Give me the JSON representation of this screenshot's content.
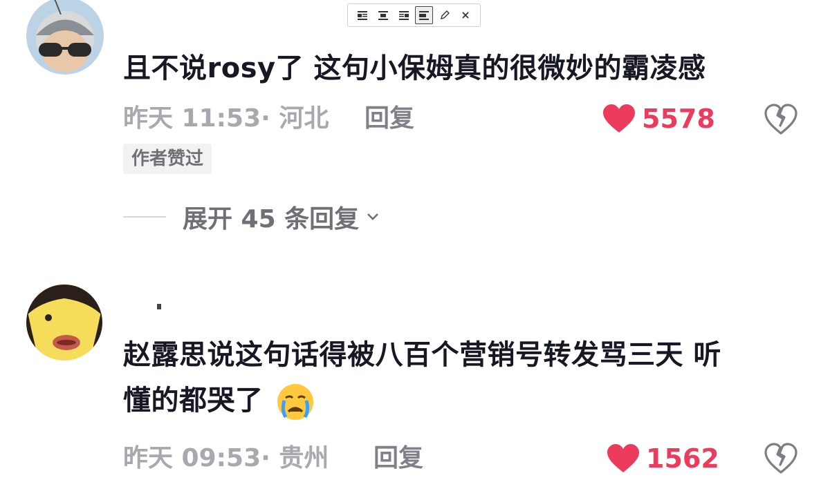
{
  "toolbar": {
    "buttons": [
      "align-left-icon",
      "align-center-icon",
      "align-right-icon",
      "align-justify-icon",
      "pencil-icon",
      "close-icon"
    ]
  },
  "comments": [
    {
      "text": "且不说rosy了 这句小保姆真的很微妙的霸凌感",
      "meta": "昨天 11:53· 河北",
      "reply": "回复",
      "likes": "5578",
      "badge": "作者赞过",
      "expand": "展开 45 条回复"
    },
    {
      "text_line1": "赵露思说这句话得被八百个营销号转发骂三天 听",
      "text_line2": "懂的都哭了",
      "meta": "昨天 09:53· 贵州",
      "reply": "回复",
      "likes": "1562"
    }
  ],
  "colors": {
    "like": "#ec3b5c",
    "meta": "#a8a8ae",
    "text": "#161823"
  }
}
